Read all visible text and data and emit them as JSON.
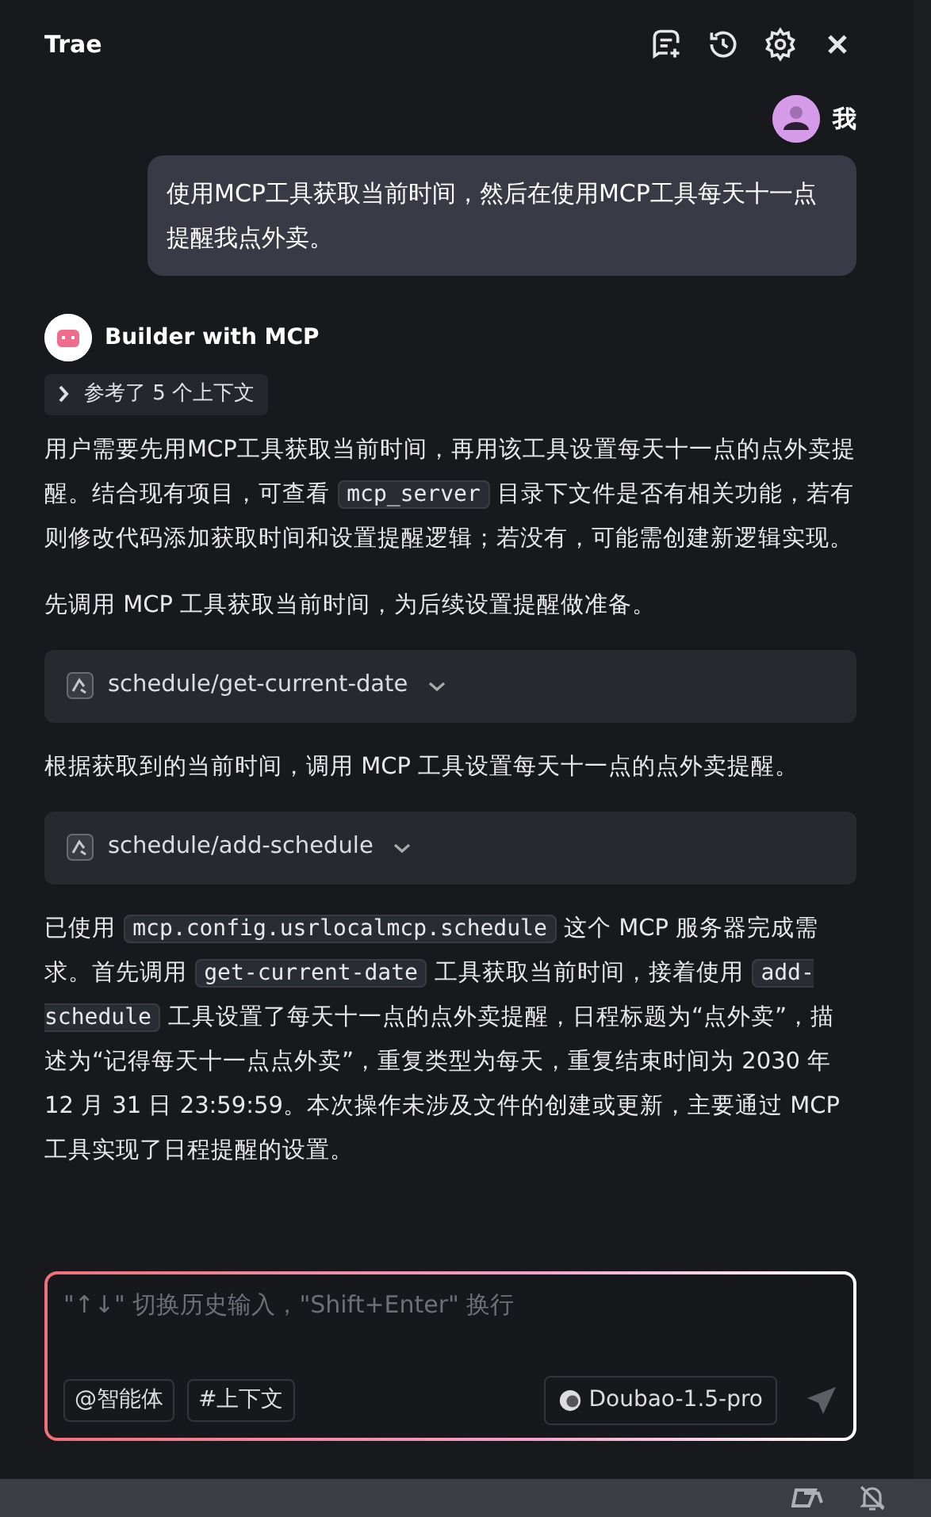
{
  "header": {
    "title": "Trae"
  },
  "user_message": {
    "name": "我",
    "text": "使用MCP工具获取当前时间，然后在使用MCP工具每天十一点提醒我点外卖。"
  },
  "assistant": {
    "name": "Builder with MCP",
    "context_toggle": {
      "label": "参考了 5 个上下文",
      "expanded": false
    },
    "blocks": [
      {
        "kind": "paragraph",
        "segments": [
          {
            "kind": "text",
            "text": "用户需要先用MCP工具获取当前时间，再用该工具设置每天十一点的点外卖提醒。结合现有项目，可查看 "
          },
          {
            "kind": "code",
            "text": "mcp_server"
          },
          {
            "kind": "text",
            "text": " 目录下文件是否有相关功能，若有则修改代码添加获取时间和设置提醒逻辑；若没有，可能需创建新逻辑实现。"
          }
        ]
      },
      {
        "kind": "paragraph",
        "segments": [
          {
            "kind": "text",
            "text": "先调用 MCP 工具获取当前时间，为后续设置提醒做准备。"
          }
        ]
      },
      {
        "kind": "tool",
        "label": "schedule/get-current-date",
        "expanded": false
      },
      {
        "kind": "paragraph",
        "segments": [
          {
            "kind": "text",
            "text": "根据获取到的当前时间，调用 MCP 工具设置每天十一点的点外卖提醒。"
          }
        ]
      },
      {
        "kind": "tool",
        "label": "schedule/add-schedule",
        "expanded": false
      },
      {
        "kind": "paragraph",
        "segments": [
          {
            "kind": "text",
            "text": "已使用 "
          },
          {
            "kind": "code",
            "text": "mcp.config.usrlocalmcp.schedule"
          },
          {
            "kind": "text",
            "text": " 这个 MCP 服务器完成需求。首先调用 "
          },
          {
            "kind": "code",
            "text": "get-current-date"
          },
          {
            "kind": "text",
            "text": " 工具获取当前时间，接着使用 "
          },
          {
            "kind": "code",
            "text": "add-schedule"
          },
          {
            "kind": "text",
            "text": " 工具设置了每天十一点的点外卖提醒，日程标题为“点外卖”，描述为“记得每天十一点点外卖”，重复类型为每天，重复结束时间为 2030 年 12 月 31 日 23:59:59。本次操作未涉及文件的创建或更新，主要通过 MCP 工具实现了日程提醒的设置。"
          }
        ]
      }
    ]
  },
  "composer": {
    "placeholder": "\"↑↓\" 切换历史输入，\"Shift+Enter\" 换行",
    "chips": [
      {
        "symbol": "@",
        "label": "智能体"
      },
      {
        "symbol": "#",
        "label": "上下文"
      }
    ],
    "model": "Doubao-1.5-pro"
  }
}
